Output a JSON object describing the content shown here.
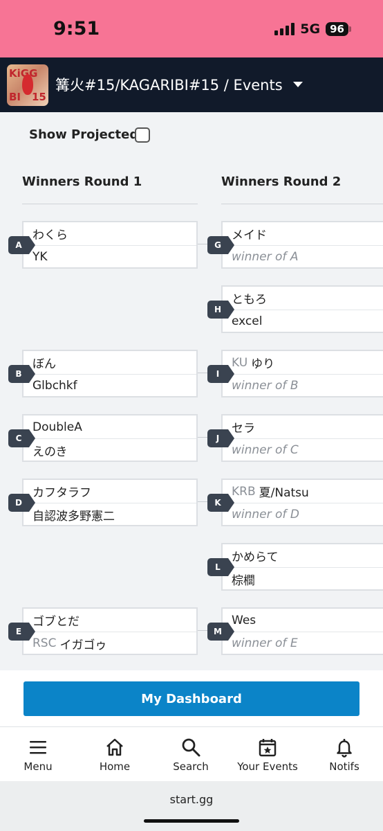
{
  "status": {
    "time": "9:51",
    "network": "5G",
    "battery": "96"
  },
  "header": {
    "title": "篝火#15/KAGARIBI#15  /  Events",
    "logo_text": "KAGARIBI 15"
  },
  "controls": {
    "show_projected_label": "Show Projected",
    "show_projected_checked": false
  },
  "rounds": [
    {
      "title": "Winners Round 1"
    },
    {
      "title": "Winners Round 2"
    }
  ],
  "round1": [
    {
      "id": "A",
      "p1": {
        "prefix": "",
        "name": "わくら"
      },
      "p2": {
        "prefix": "",
        "name": "YK"
      }
    },
    {
      "id": "B",
      "p1": {
        "prefix": "",
        "name": "ぼん"
      },
      "p2": {
        "prefix": "",
        "name": "Glbchkf"
      }
    },
    {
      "id": "C",
      "p1": {
        "prefix": "",
        "name": "DoubleA"
      },
      "p2": {
        "prefix": "",
        "name": "えのき"
      }
    },
    {
      "id": "D",
      "p1": {
        "prefix": "",
        "name": "カフタラフ"
      },
      "p2": {
        "prefix": "",
        "name": "自認波多野憲二"
      }
    },
    {
      "id": "E",
      "p1": {
        "prefix": "",
        "name": "ゴブとだ"
      },
      "p2": {
        "prefix": "RSC",
        "name": "イガゴゥ"
      }
    }
  ],
  "round2": [
    {
      "id": "G",
      "p1": {
        "prefix": "",
        "name": "メイド"
      },
      "p2": {
        "prefix": "",
        "name": "winner of A",
        "tbd": true
      }
    },
    {
      "id": "H",
      "p1": {
        "prefix": "",
        "name": "ともろ"
      },
      "p2": {
        "prefix": "",
        "name": "excel"
      }
    },
    {
      "id": "I",
      "p1": {
        "prefix": "KU",
        "name": "ゆり"
      },
      "p2": {
        "prefix": "",
        "name": "winner of B",
        "tbd": true
      }
    },
    {
      "id": "J",
      "p1": {
        "prefix": "",
        "name": "セラ"
      },
      "p2": {
        "prefix": "",
        "name": "winner of C",
        "tbd": true
      }
    },
    {
      "id": "K",
      "p1": {
        "prefix": "KRB",
        "name": "夏/Natsu"
      },
      "p2": {
        "prefix": "",
        "name": "winner of D",
        "tbd": true
      }
    },
    {
      "id": "L",
      "p1": {
        "prefix": "",
        "name": "かめらて"
      },
      "p2": {
        "prefix": "",
        "name": "棕櫚"
      }
    },
    {
      "id": "M",
      "p1": {
        "prefix": "",
        "name": "Wes"
      },
      "p2": {
        "prefix": "",
        "name": "winner of E",
        "tbd": true
      }
    }
  ],
  "dashboard": {
    "label": "My Dashboard"
  },
  "nav": [
    {
      "label": "Menu",
      "icon": "menu-icon"
    },
    {
      "label": "Home",
      "icon": "home-icon"
    },
    {
      "label": "Search",
      "icon": "search-icon"
    },
    {
      "label": "Your Events",
      "icon": "calendar-star-icon"
    },
    {
      "label": "Notifs",
      "icon": "bell-icon"
    }
  ],
  "browser": {
    "url": "start.gg"
  },
  "colors": {
    "header_bg": "#111a2a",
    "status_bg": "#f77495",
    "accent": "#0b84c8",
    "tag_bg": "#3a4350"
  }
}
